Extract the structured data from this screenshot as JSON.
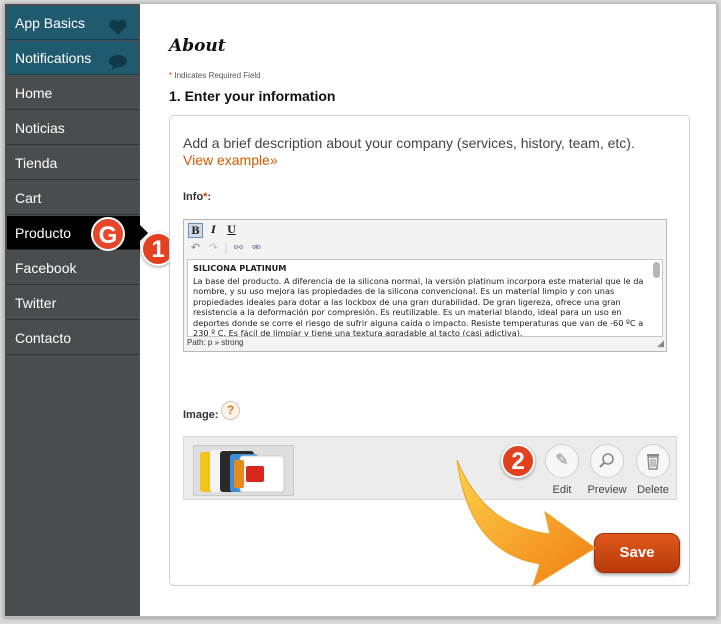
{
  "sidebar": {
    "items": [
      {
        "label": "App Basics",
        "icon": "heart-icon"
      },
      {
        "label": "Notifications",
        "icon": "speech-bubble-icon"
      },
      {
        "label": "Home"
      },
      {
        "label": "Noticias"
      },
      {
        "label": "Tienda"
      },
      {
        "label": "Cart"
      },
      {
        "label": "Producto",
        "active": true
      },
      {
        "label": "Facebook"
      },
      {
        "label": "Twitter"
      },
      {
        "label": "Contacto"
      }
    ],
    "active_badge": "G"
  },
  "page": {
    "title": "About",
    "required_star": "*",
    "required_note": "Indicates Required Field",
    "section_heading": "1. Enter your information"
  },
  "form": {
    "description": "Add a brief description about your company (services, history, team, etc).",
    "example_link": "View example»",
    "info_label": "Info",
    "info_star": "*",
    "info_colon": ":",
    "editor": {
      "content_heading": "SILICONA PLATINUM",
      "content_body": "La base del producto. A diferencia de la silicona normal, la versión platinum incorpora este material que le da nombre, y su uso mejora las propiedades de la silicona convencional. Es un material limpio y con unas propiedades ideales para dotar a las lockbox de una gran durabilidad. De gran ligereza, ofrece una gran resistencia a la deformación por compresión. Es reutilizable. Es un material blando, ideal para un uso en deportes donde se corre el riesgo de sufrir alguna caída o impacto. Resiste temperaturas que van de -60 ºC a 230 º C. Es fácil de limpiar y tiene una textura agradable al tacto (casi adictiva).",
      "path": "Path: p » strong"
    },
    "image_label": "Image:",
    "help": "?",
    "tools": {
      "edit": "Edit",
      "preview": "Preview",
      "delete": "Delete"
    },
    "save": "Save"
  },
  "steps": {
    "one": "1",
    "two": "2"
  },
  "colors": {
    "accent_orange": "#d45a00",
    "sidebar": "#4a4c4e",
    "sidebar_top": "#1f5a6e",
    "badge_red": "#e3401f"
  }
}
